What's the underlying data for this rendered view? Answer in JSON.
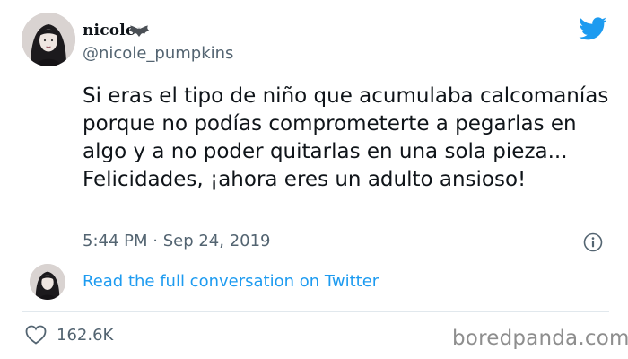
{
  "user": {
    "display_name": "nicole",
    "handle": "@nicole_pumpkins",
    "name_emoji": "bat-icon",
    "avatar": "user-avatar"
  },
  "brand": {
    "logo": "twitter-bird-icon",
    "color": "#1d9bf0"
  },
  "tweet": {
    "text": "Si eras el tipo de niño que acumulaba calcomanías porque no podías comprometerte a pegarlas en algo y a no poder quitarlas en una sola pieza... Felicidades, ¡ahora eres un adulto ansioso!",
    "timestamp": "5:44 PM · Sep 24, 2019"
  },
  "conversation_link": "Read the full conversation on Twitter",
  "likes": {
    "count": "162.6K",
    "icon": "heart-icon"
  },
  "watermark": "boredpanda.com",
  "colors": {
    "text": "#0f1419",
    "secondary": "#536471",
    "link": "#1d9bf0",
    "divider": "#e1e8ed"
  }
}
